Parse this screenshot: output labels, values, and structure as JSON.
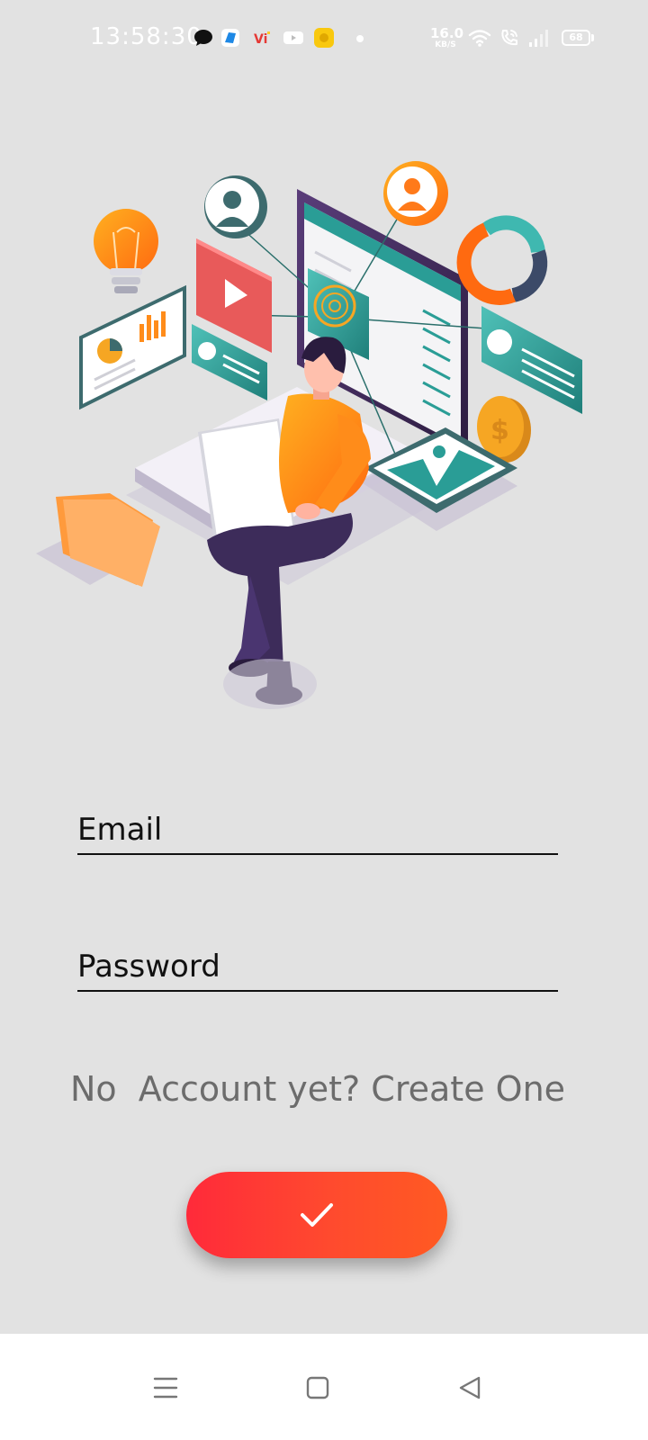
{
  "status_bar": {
    "time": "13:58:30",
    "net_speed_value": "16.0",
    "net_speed_unit": "KB/S",
    "battery_level": "68",
    "notification_icons": [
      "chat-bubble-icon",
      "app-icon",
      "vi-icon",
      "youtube-icon",
      "yellow-app-icon"
    ],
    "system_icons": [
      "wifi-icon",
      "wifi-call-icon",
      "signal-icon",
      "battery-icon"
    ]
  },
  "hero": {
    "icon": "person-with-laptop-illustration"
  },
  "form": {
    "email_placeholder": "Email",
    "password_placeholder": "Password",
    "signup_text": "No  Account yet? Create One",
    "submit_icon": "checkmark-icon"
  },
  "nav_bar": {
    "icons": [
      "menu-icon",
      "home-square-icon",
      "back-triangle-icon"
    ]
  },
  "colors": {
    "background": "#e2e2e2",
    "accent_start": "#ff2a3a",
    "accent_end": "#ff5a22",
    "orange": "#ff8c1a",
    "teal": "#2a9d96"
  }
}
